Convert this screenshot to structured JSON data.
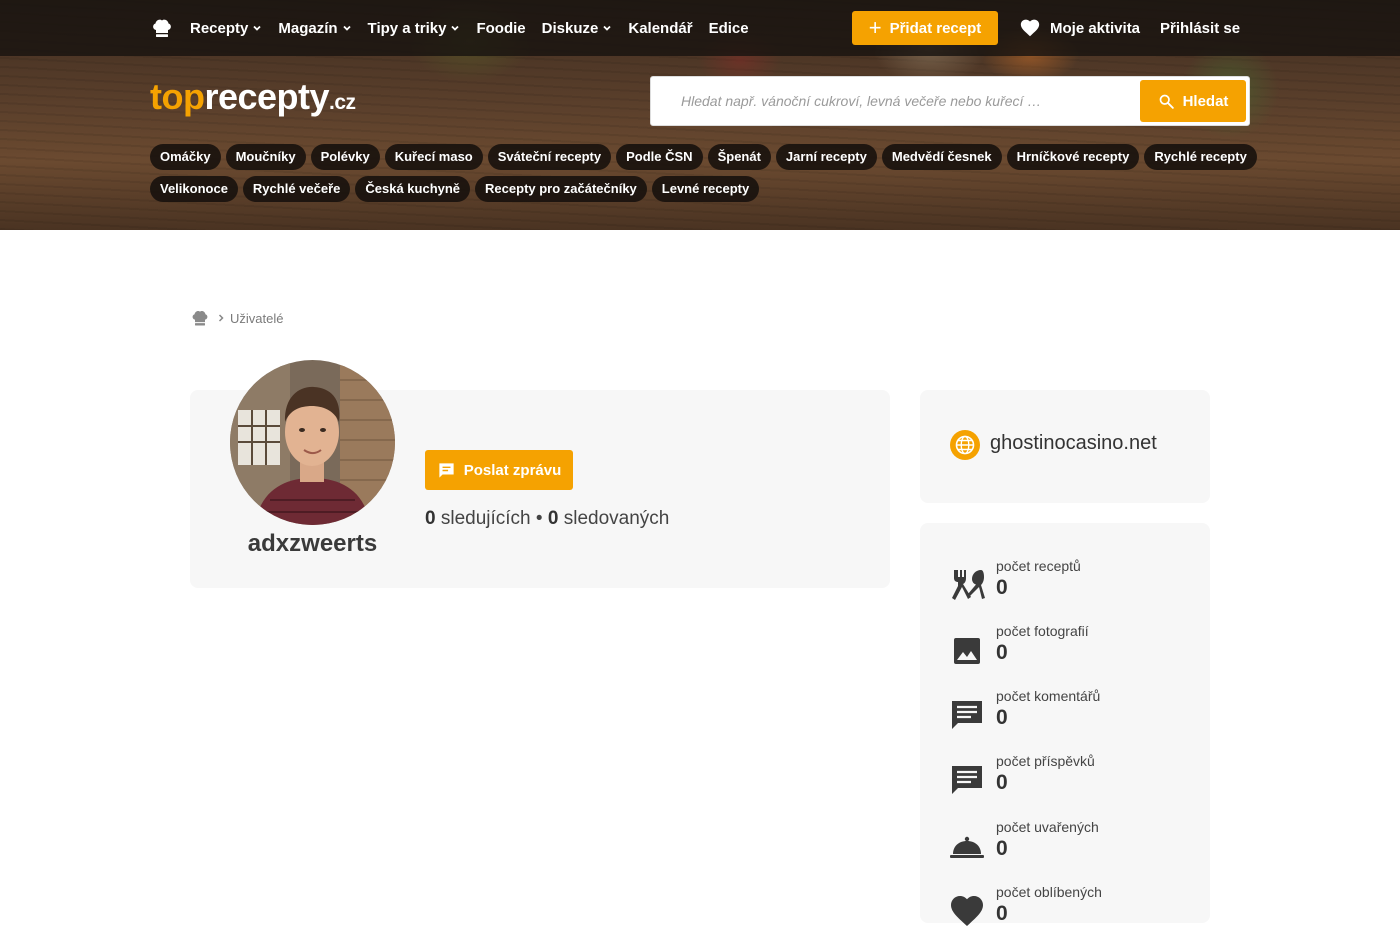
{
  "nav": {
    "items": [
      {
        "label": "Recepty",
        "has_dropdown": true
      },
      {
        "label": "Magazín",
        "has_dropdown": true
      },
      {
        "label": "Tipy a triky",
        "has_dropdown": true
      },
      {
        "label": "Foodie",
        "has_dropdown": false
      },
      {
        "label": "Diskuze",
        "has_dropdown": true
      },
      {
        "label": "Kalendář",
        "has_dropdown": false
      },
      {
        "label": "Edice",
        "has_dropdown": false
      }
    ],
    "add_recipe": "Přidat recept",
    "activity": "Moje aktivita",
    "login": "Přihlásit se"
  },
  "logo": {
    "part1": "top",
    "part2": "recepty",
    "part3": ".cz"
  },
  "search": {
    "placeholder": "Hledat např. vánoční cukroví, levná večeře nebo kuřecí …",
    "button": "Hledat"
  },
  "tags": {
    "row1": [
      "Omáčky",
      "Moučníky",
      "Polévky",
      "Kuřecí maso",
      "Sváteční recepty",
      "Podle ČSN",
      "Špenát",
      "Jarní recepty",
      "Medvědí česnek",
      "Hrníčkové recepty",
      "Rychlé recepty"
    ],
    "row2": [
      "Velikonoce",
      "Rychlé večeře",
      "Česká kuchyně",
      "Recepty pro začátečníky",
      "Levné recepty"
    ]
  },
  "breadcrumb": {
    "current": "Uživatelé"
  },
  "profile": {
    "username": "adxzweerts",
    "message_button": "Poslat zprávu",
    "followers": "0",
    "followers_label": "sledujících",
    "separator": "•",
    "following": "0",
    "following_label": "sledovaných"
  },
  "website": {
    "url": "ghostinocasino.net"
  },
  "stats": [
    {
      "label": "počet receptů",
      "value": "0",
      "icon": "utensils-icon"
    },
    {
      "label": "počet fotografií",
      "value": "0",
      "icon": "image-icon"
    },
    {
      "label": "počet komentářů",
      "value": "0",
      "icon": "comment-icon"
    },
    {
      "label": "počet příspěvků",
      "value": "0",
      "icon": "post-icon"
    },
    {
      "label": "počet uvařených",
      "value": "0",
      "icon": "cloche-icon"
    },
    {
      "label": "počet oblíbených",
      "value": "0",
      "icon": "heart-icon"
    }
  ],
  "colors": {
    "accent": "#f5a201",
    "card_bg": "#f7f7f7",
    "topbar": "#19140f"
  }
}
